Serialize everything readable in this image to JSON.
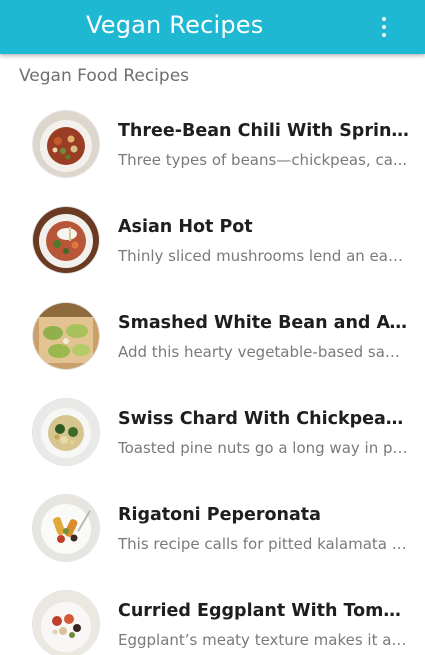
{
  "app_bar": {
    "title": "Vegan Recipes",
    "background": "#1fb8d3",
    "overflow_icon": "more-vertical-icon"
  },
  "section": {
    "header": "Vegan Food Recipes"
  },
  "recipes": [
    {
      "title": "Three-Bean Chili With Spring Pe...",
      "description": "Three types of beans—chickpeas, ca...",
      "thumb_icon": "chili-bowl-photo"
    },
    {
      "title": "Asian Hot Pot",
      "description": "Thinly sliced mushrooms lend an eart...",
      "thumb_icon": "hot-pot-photo"
    },
    {
      "title": "Smashed White Bean and Avoca...",
      "description": "Add this hearty vegetable-based sand...",
      "thumb_icon": "avocado-toast-photo"
    },
    {
      "title": "Swiss Chard With Chickpeas an...",
      "description": "Toasted pine nuts go a long way in pr...",
      "thumb_icon": "swiss-chard-plate-photo"
    },
    {
      "title": "Rigatoni Peperonata",
      "description": "This recipe calls for pitted kalamata o...",
      "thumb_icon": "rigatoni-plate-photo"
    },
    {
      "title": "Curried Eggplant With Tomatoe...",
      "description": "Eggplant’s meaty texture makes it a g...",
      "thumb_icon": "curried-eggplant-photo"
    }
  ]
}
